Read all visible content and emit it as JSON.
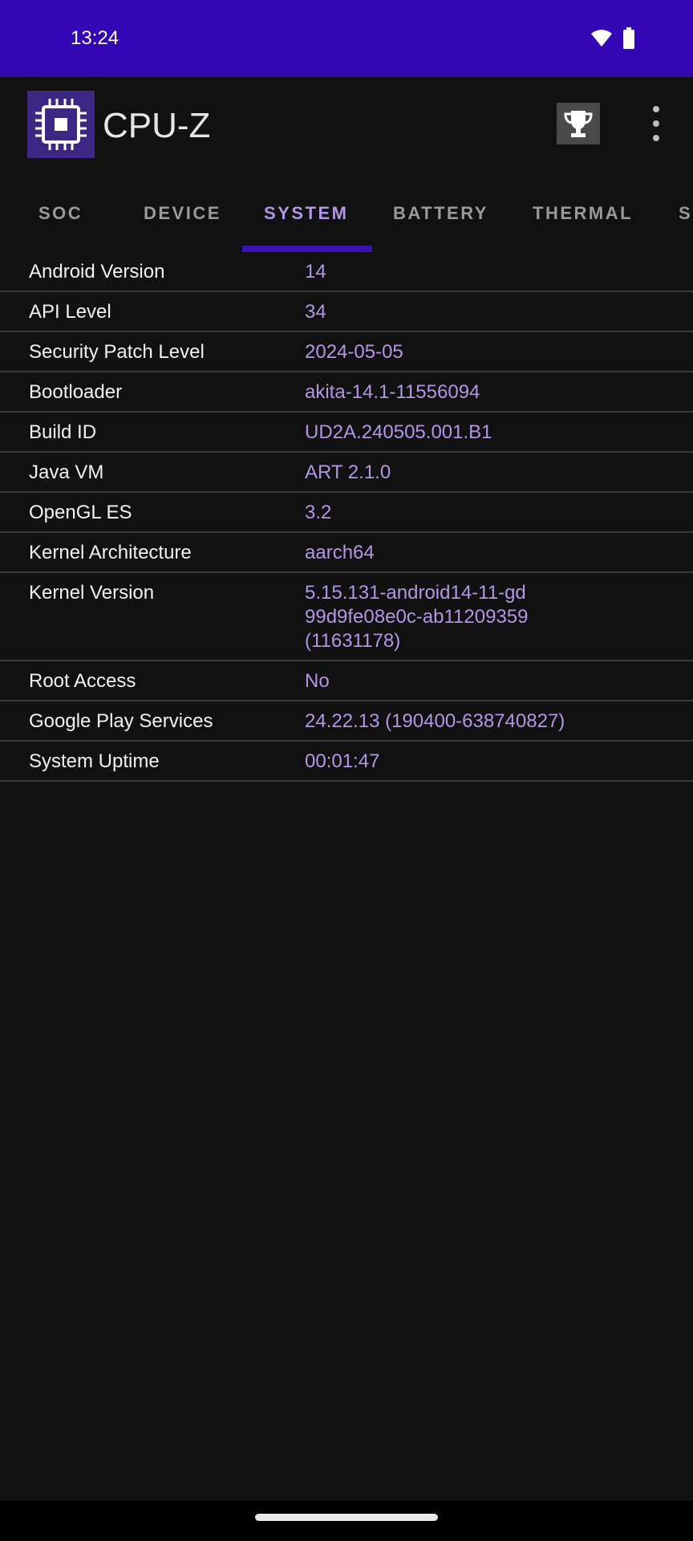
{
  "status_bar": {
    "time": "13:24",
    "icons": [
      "wifi-icon",
      "battery-icon"
    ]
  },
  "app_bar": {
    "title": "CPU-Z",
    "icons": [
      "cpu-chip-icon",
      "trophy-icon",
      "more-vert-icon"
    ]
  },
  "tabs": [
    {
      "label": "SOC",
      "active": false
    },
    {
      "label": "DEVICE",
      "active": false
    },
    {
      "label": "SYSTEM",
      "active": true
    },
    {
      "label": "BATTERY",
      "active": false
    },
    {
      "label": "THERMAL",
      "active": false
    },
    {
      "label": "S",
      "active": false
    }
  ],
  "system_info": [
    {
      "label": "Android Version",
      "value": [
        "14"
      ]
    },
    {
      "label": "API Level",
      "value": [
        "34"
      ]
    },
    {
      "label": "Security Patch Level",
      "value": [
        "2024-05-05"
      ]
    },
    {
      "label": "Bootloader",
      "value": [
        "akita-14.1-11556094"
      ]
    },
    {
      "label": "Build ID",
      "value": [
        "UD2A.240505.001.B1"
      ]
    },
    {
      "label": "Java VM",
      "value": [
        "ART 2.1.0"
      ]
    },
    {
      "label": "OpenGL ES",
      "value": [
        "3.2"
      ]
    },
    {
      "label": "Kernel Architecture",
      "value": [
        "aarch64"
      ]
    },
    {
      "label": "Kernel Version",
      "value": [
        "5.15.131-android14-11-gd",
        "99d9fe08e0c-ab11209359",
        "(11631178)"
      ]
    },
    {
      "label": "Root Access",
      "value": [
        "No"
      ]
    },
    {
      "label": "Google Play Services",
      "value": [
        "24.22.13 (190400-638740827)"
      ]
    },
    {
      "label": "System Uptime",
      "value": [
        "00:01:47"
      ]
    }
  ],
  "colors": {
    "status_bar": "#3407b4",
    "background": "#111111",
    "accent": "#b396ea",
    "tab_indicator": "#3a13b7"
  }
}
